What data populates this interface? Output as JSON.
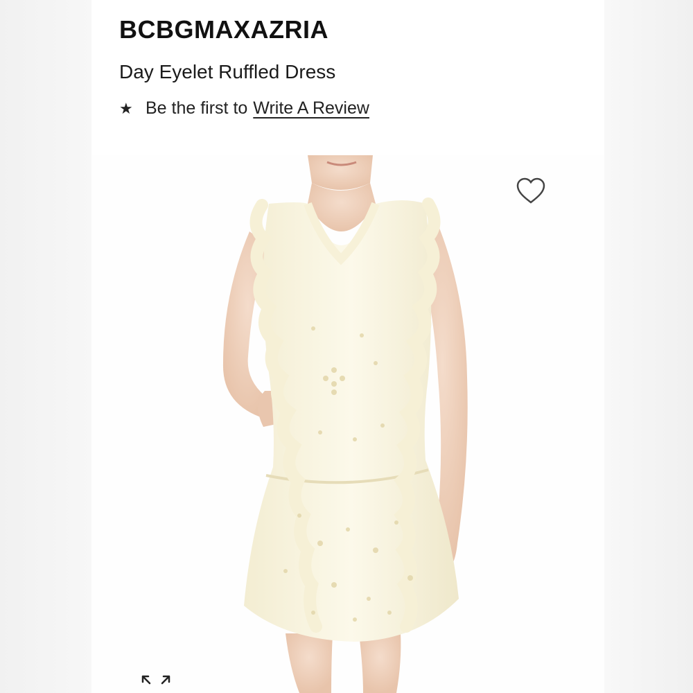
{
  "product": {
    "brand": "BCBGMAXAZRIA",
    "name": "Day Eyelet Ruffled Dress"
  },
  "reviews": {
    "star_icon": "star-icon",
    "prompt": "Be the first to",
    "link_label": "Write A Review"
  },
  "gallery": {
    "wishlist_icon": "heart-icon",
    "expand_icon": "expand-icon",
    "dress_color": "#fbf7e4"
  }
}
